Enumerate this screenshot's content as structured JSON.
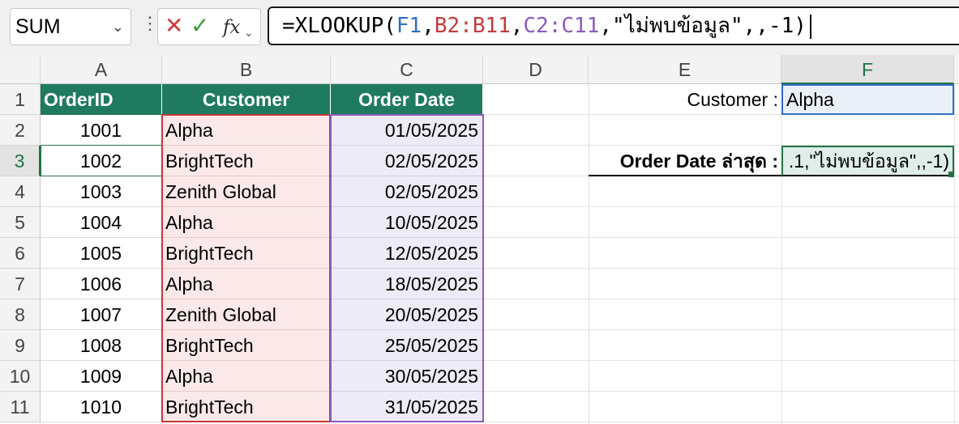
{
  "formula_bar": {
    "name_box": "SUM",
    "fx_label": "fx",
    "formula": {
      "prefix": "=XLOOKUP(",
      "ref1": "F1",
      "sep1": ",",
      "ref2": "B2:B11",
      "sep2": ",",
      "ref3": "C2:C11",
      "rest": ",\"ไม่พบข้อมูล\",,-1)"
    }
  },
  "columns": [
    "A",
    "B",
    "C",
    "D",
    "E",
    "F"
  ],
  "rows": [
    "1",
    "2",
    "3",
    "4",
    "5",
    "6",
    "7",
    "8",
    "9",
    "10",
    "11"
  ],
  "table": {
    "headers": [
      "OrderID",
      "Customer",
      "Order Date"
    ],
    "data": [
      [
        "1001",
        "Alpha",
        "01/05/2025"
      ],
      [
        "1002",
        "BrightTech",
        "02/05/2025"
      ],
      [
        "1003",
        "Zenith Global",
        "02/05/2025"
      ],
      [
        "1004",
        "Alpha",
        "10/05/2025"
      ],
      [
        "1005",
        "BrightTech",
        "12/05/2025"
      ],
      [
        "1006",
        "Alpha",
        "18/05/2025"
      ],
      [
        "1007",
        "Zenith Global",
        "20/05/2025"
      ],
      [
        "1008",
        "BrightTech",
        "25/05/2025"
      ],
      [
        "1009",
        "Alpha",
        "30/05/2025"
      ],
      [
        "1010",
        "BrightTech",
        "31/05/2025"
      ]
    ]
  },
  "lookup": {
    "customer_label": "Customer :",
    "customer_value": "Alpha",
    "order_label": "Order Date ล่าสุด :",
    "order_cell_text": ".1,\"ไม่พบข้อมูล\",,-1)"
  },
  "colors": {
    "header_fill": "#1f7a60",
    "ref_f1": "#2e6fc4",
    "ref_b": "#c43b3b",
    "ref_c": "#8a5bbd",
    "excel_green": "#217346"
  }
}
